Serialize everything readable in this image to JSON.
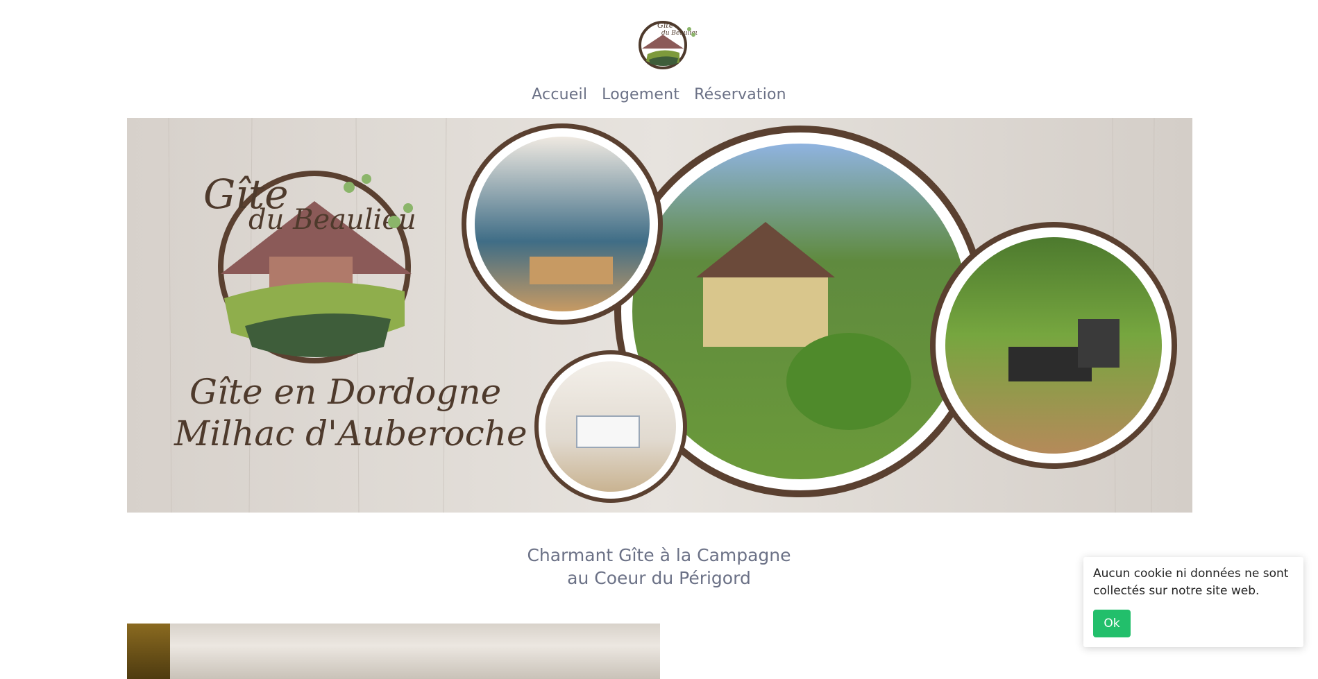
{
  "nav": {
    "items": [
      {
        "label": "Accueil"
      },
      {
        "label": "Logement"
      },
      {
        "label": "Réservation"
      }
    ]
  },
  "logo": {
    "line1": "Gîte",
    "line2": "du Beaulieu"
  },
  "banner": {
    "title_line1": "Gîte en Dordogne",
    "title_line2": "Milhac d'Auberoche"
  },
  "main": {
    "heading_line1": "Charmant Gîte à la Campagne",
    "heading_line2": "au Coeur du Périgord"
  },
  "cookie": {
    "message": "Aucun cookie ni données ne sont collectés sur notre site web.",
    "ok_label": "Ok"
  },
  "colors": {
    "accent": "#22bf6b",
    "nav_text": "#6b7186",
    "brown": "#5a4030"
  }
}
